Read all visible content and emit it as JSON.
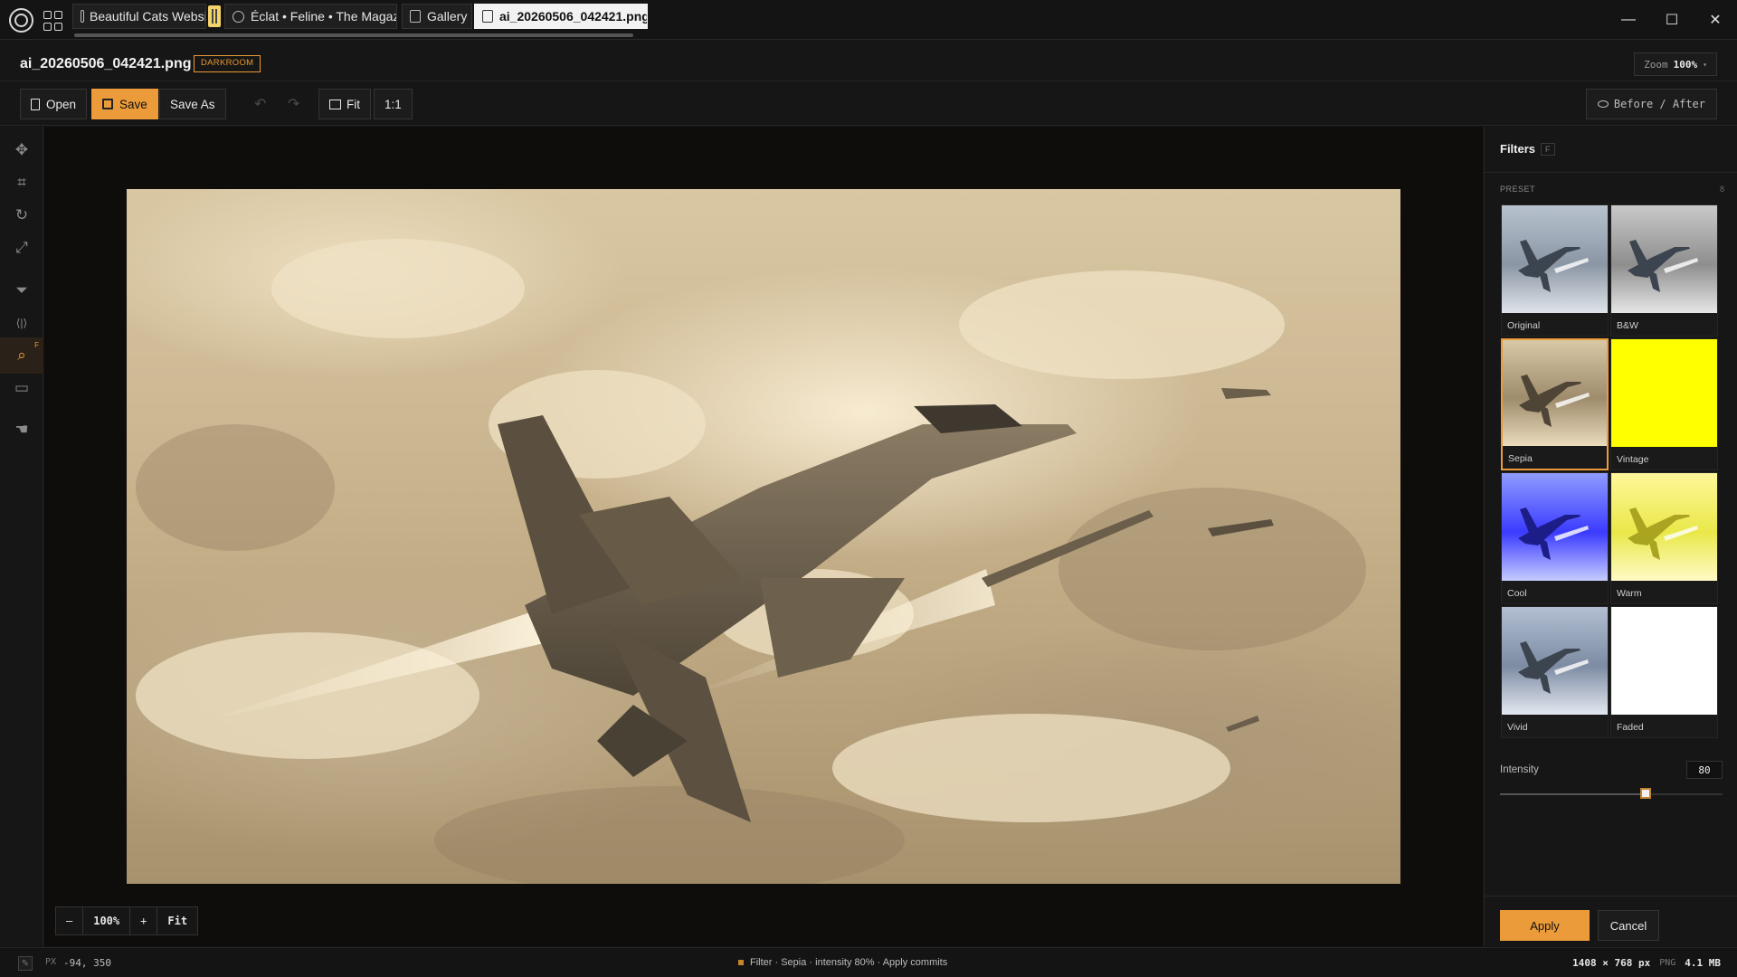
{
  "tabs": [
    {
      "label": "Beautiful Cats Website",
      "icon": "document-icon"
    },
    {
      "label": "Éclat • Feline • The Magaz...",
      "icon": "globe-icon"
    },
    {
      "label": "Gallery",
      "icon": "document-icon"
    },
    {
      "label": "ai_20260506_042421.png",
      "icon": "document-icon",
      "active": true
    }
  ],
  "window": {
    "minimize": "—",
    "maximize": "☐",
    "close": "✕"
  },
  "header": {
    "filename": "ai_20260506_042421.png",
    "mode_badge": "DARKROOM",
    "zoom_label": "Zoom",
    "zoom_value": "100%",
    "zoom_caret": "▾"
  },
  "toolbar": {
    "open": "Open",
    "save": "Save",
    "save_as": "Save As",
    "undo": "↶",
    "redo": "↷",
    "fit": "Fit",
    "one_to_one": "1:1",
    "before_after": "Before / After"
  },
  "tools": [
    {
      "name": "move-icon",
      "glyph": "✥"
    },
    {
      "name": "crop-icon",
      "glyph": "⌗"
    },
    {
      "name": "rotate-icon",
      "glyph": "↻"
    },
    {
      "name": "resize-icon",
      "glyph": "⤢"
    },
    {
      "name": "filter-icon",
      "glyph": "⏷"
    },
    {
      "name": "flip-icon",
      "glyph": "⟨|⟩"
    },
    {
      "name": "zoom-icon",
      "glyph": "⌕",
      "active": true,
      "badge": "F"
    },
    {
      "name": "frame-icon",
      "glyph": "▭"
    },
    {
      "name": "hand-icon",
      "glyph": "☚"
    }
  ],
  "canvas_zoom": {
    "minus": "–",
    "value": "100%",
    "plus": "+",
    "fit": "Fit"
  },
  "panel": {
    "title": "Filters",
    "shortcut": "F",
    "preset_label": "PRESET",
    "preset_count": "8",
    "presets": [
      {
        "label": "Original",
        "style": "original"
      },
      {
        "label": "B&W",
        "style": "bw"
      },
      {
        "label": "Sepia",
        "style": "sepia",
        "selected": true
      },
      {
        "label": "Vintage",
        "style": "vintage"
      },
      {
        "label": "Cool",
        "style": "cool"
      },
      {
        "label": "Warm",
        "style": "warm"
      },
      {
        "label": "Vivid",
        "style": "vivid"
      },
      {
        "label": "Faded",
        "style": "faded"
      }
    ],
    "intensity_label": "Intensity",
    "intensity_value": "80",
    "intensity": 0.8,
    "apply": "Apply",
    "cancel": "Cancel"
  },
  "status": {
    "coord_label": "PX",
    "coords": "-94, 350",
    "message": "Filter · Sepia · intensity 80% · Apply commits",
    "dimensions": "1408 × 768 px",
    "format": "PNG",
    "filesize": "4.1 MB"
  },
  "colors": {
    "accent": "#eb9b3a",
    "background": "#141414",
    "panel": "#161616"
  }
}
